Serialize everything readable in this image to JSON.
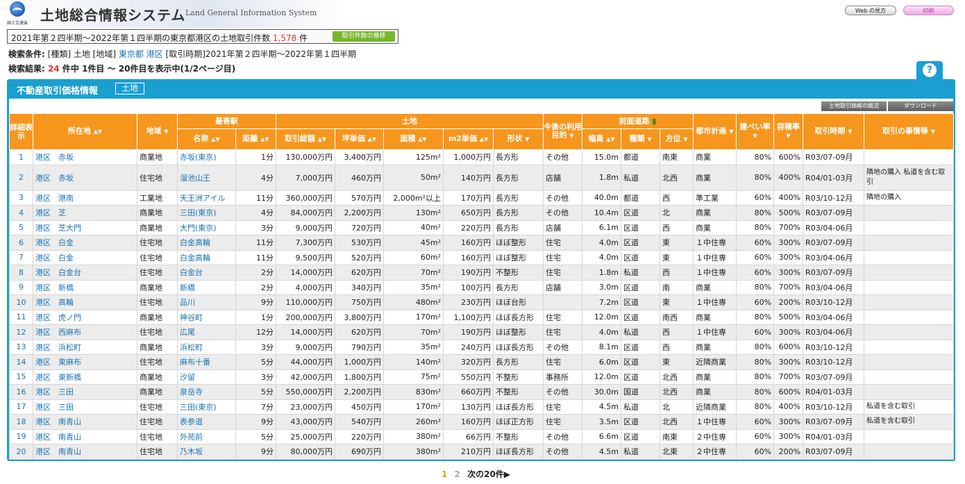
{
  "header": {
    "logo_text": "国土交通省",
    "title": "土地総合情報システム",
    "subtitle": "Land General Information System",
    "web_help_label": "Web の見方",
    "print_label": "印刷"
  },
  "summary": {
    "text_before": "2021年第２四半期〜2022年第１四半期の東京都港区の土地取引件数",
    "count": "1,578",
    "unit": "件",
    "trend_button": "取引件数の推移"
  },
  "conditions": {
    "label": "検索条件:",
    "type": "[種類] 土地",
    "area_label": "[地域]",
    "pref": "東京都",
    "city": "港区",
    "period": "[取引時期]2021年第２四半期〜2022年第１四半期"
  },
  "result": {
    "label": "検索結果:",
    "total": "24",
    "rest": "件中 1件目 〜 20件目を表示中(1/2ページ目)"
  },
  "panel": {
    "title": "不動産取引価格情報",
    "tag": "土地",
    "overview_button": "土地取引価格の概況",
    "download_button": "ダウンロード"
  },
  "table": {
    "headers": {
      "detail": "詳細表示",
      "location": "所在地",
      "district": "地域",
      "station_group": "最寄駅",
      "station_name": "名称",
      "distance": "距離",
      "land_group": "土地",
      "total_price": "取引総額",
      "tsubo_price": "坪単価",
      "area": "面積",
      "unit_price": "m2単価",
      "shape": "形状",
      "future_use": "今後の利用目的",
      "road_group": "前面道路",
      "width": "幅員",
      "road_type": "種類",
      "direction": "方位",
      "city_plan": "都市計画",
      "coverage": "建ぺい率",
      "floor_ratio": "容積率",
      "period": "取引時期",
      "circumstances": "取引の事情等"
    },
    "rows": [
      {
        "no": "1",
        "loc": "港区　赤坂",
        "district": "商業地",
        "station": "赤坂(東京)",
        "dist": "1分",
        "total": "130,000万円",
        "tsubo": "3,400万円",
        "area": "125m²",
        "unit": "1,000万円",
        "shape": "長方形",
        "use": "その他",
        "width": "15.0m",
        "rtype": "都道",
        "dir": "南東",
        "plan": "商業",
        "cov": "80%",
        "far": "600%",
        "period": "R03/07-09月",
        "note": ""
      },
      {
        "no": "2",
        "loc": "港区　赤坂",
        "district": "住宅地",
        "station": "溜池山王",
        "dist": "4分",
        "total": "7,000万円",
        "tsubo": "460万円",
        "area": "50m²",
        "unit": "140万円",
        "shape": "長方形",
        "use": "店舗",
        "width": "1.8m",
        "rtype": "私道",
        "dir": "北西",
        "plan": "商業",
        "cov": "80%",
        "far": "400%",
        "period": "R04/01-03月",
        "note": "隣地の購入 私道を含む取引"
      },
      {
        "no": "3",
        "loc": "港区　港南",
        "district": "工業地",
        "station": "天王洲アイル",
        "dist": "11分",
        "total": "360,000万円",
        "tsubo": "570万円",
        "area": "2,000m²以上",
        "unit": "170万円",
        "shape": "長方形",
        "use": "その他",
        "width": "40.0m",
        "rtype": "都道",
        "dir": "西",
        "plan": "準工業",
        "cov": "60%",
        "far": "400%",
        "period": "R03/10-12月",
        "note": "隣地の購入"
      },
      {
        "no": "4",
        "loc": "港区　芝",
        "district": "商業地",
        "station": "三田(東京)",
        "dist": "4分",
        "total": "84,000万円",
        "tsubo": "2,200万円",
        "area": "130m²",
        "unit": "650万円",
        "shape": "長方形",
        "use": "その他",
        "width": "10.4m",
        "rtype": "区道",
        "dir": "北",
        "plan": "商業",
        "cov": "80%",
        "far": "500%",
        "period": "R03/07-09月",
        "note": ""
      },
      {
        "no": "5",
        "loc": "港区　芝大門",
        "district": "商業地",
        "station": "大門(東京)",
        "dist": "3分",
        "total": "9,000万円",
        "tsubo": "720万円",
        "area": "40m²",
        "unit": "220万円",
        "shape": "長方形",
        "use": "店舗",
        "width": "6.1m",
        "rtype": "区道",
        "dir": "西",
        "plan": "商業",
        "cov": "80%",
        "far": "700%",
        "period": "R03/04-06月",
        "note": ""
      },
      {
        "no": "6",
        "loc": "港区　白金",
        "district": "住宅地",
        "station": "白金高輪",
        "dist": "11分",
        "total": "7,300万円",
        "tsubo": "530万円",
        "area": "45m²",
        "unit": "160万円",
        "shape": "ほぼ整形",
        "use": "住宅",
        "width": "4.0m",
        "rtype": "区道",
        "dir": "東",
        "plan": "１中住専",
        "cov": "60%",
        "far": "300%",
        "period": "R03/07-09月",
        "note": ""
      },
      {
        "no": "7",
        "loc": "港区　白金",
        "district": "住宅地",
        "station": "白金高輪",
        "dist": "11分",
        "total": "9,500万円",
        "tsubo": "520万円",
        "area": "60m²",
        "unit": "160万円",
        "shape": "ほぼ整形",
        "use": "住宅",
        "width": "4.0m",
        "rtype": "区道",
        "dir": "東",
        "plan": "１中住専",
        "cov": "60%",
        "far": "300%",
        "period": "R03/04-06月",
        "note": ""
      },
      {
        "no": "8",
        "loc": "港区　白金台",
        "district": "住宅地",
        "station": "白金台",
        "dist": "2分",
        "total": "14,000万円",
        "tsubo": "620万円",
        "area": "70m²",
        "unit": "190万円",
        "shape": "不整形",
        "use": "住宅",
        "width": "1.8m",
        "rtype": "私道",
        "dir": "西",
        "plan": "１中住専",
        "cov": "60%",
        "far": "300%",
        "period": "R03/07-09月",
        "note": ""
      },
      {
        "no": "9",
        "loc": "港区　新橋",
        "district": "商業地",
        "station": "新橋",
        "dist": "2分",
        "total": "4,000万円",
        "tsubo": "340万円",
        "area": "35m²",
        "unit": "100万円",
        "shape": "長方形",
        "use": "店舗",
        "width": "3.0m",
        "rtype": "区道",
        "dir": "南",
        "plan": "商業",
        "cov": "80%",
        "far": "700%",
        "period": "R03/04-06月",
        "note": ""
      },
      {
        "no": "10",
        "loc": "港区　高輪",
        "district": "住宅地",
        "station": "品川",
        "dist": "9分",
        "total": "110,000万円",
        "tsubo": "750万円",
        "area": "480m²",
        "unit": "230万円",
        "shape": "ほぼ台形",
        "use": "",
        "width": "7.2m",
        "rtype": "区道",
        "dir": "東",
        "plan": "１中住専",
        "cov": "60%",
        "far": "200%",
        "period": "R03/10-12月",
        "note": ""
      },
      {
        "no": "11",
        "loc": "港区　虎ノ門",
        "district": "商業地",
        "station": "神谷町",
        "dist": "1分",
        "total": "200,000万円",
        "tsubo": "3,800万円",
        "area": "170m²",
        "unit": "1,100万円",
        "shape": "ほぼ長方形",
        "use": "住宅",
        "width": "12.0m",
        "rtype": "区道",
        "dir": "南西",
        "plan": "商業",
        "cov": "80%",
        "far": "500%",
        "period": "R03/04-06月",
        "note": ""
      },
      {
        "no": "12",
        "loc": "港区　西麻布",
        "district": "住宅地",
        "station": "広尾",
        "dist": "12分",
        "total": "14,000万円",
        "tsubo": "620万円",
        "area": "70m²",
        "unit": "190万円",
        "shape": "ほぼ整形",
        "use": "住宅",
        "width": "4.0m",
        "rtype": "私道",
        "dir": "西",
        "plan": "１中住専",
        "cov": "60%",
        "far": "300%",
        "period": "R03/04-06月",
        "note": ""
      },
      {
        "no": "13",
        "loc": "港区　浜松町",
        "district": "商業地",
        "station": "浜松町",
        "dist": "3分",
        "total": "9,000万円",
        "tsubo": "790万円",
        "area": "35m²",
        "unit": "240万円",
        "shape": "ほぼ長方形",
        "use": "その他",
        "width": "8.1m",
        "rtype": "区道",
        "dir": "西",
        "plan": "商業",
        "cov": "80%",
        "far": "600%",
        "period": "R03/10-12月",
        "note": ""
      },
      {
        "no": "14",
        "loc": "港区　東麻布",
        "district": "住宅地",
        "station": "麻布十番",
        "dist": "5分",
        "total": "44,000万円",
        "tsubo": "1,000万円",
        "area": "140m²",
        "unit": "320万円",
        "shape": "長方形",
        "use": "住宅",
        "width": "6.0m",
        "rtype": "区道",
        "dir": "東",
        "plan": "近隣商業",
        "cov": "80%",
        "far": "300%",
        "period": "R03/10-12月",
        "note": ""
      },
      {
        "no": "15",
        "loc": "港区　東新橋",
        "district": "商業地",
        "station": "汐留",
        "dist": "3分",
        "total": "42,000万円",
        "tsubo": "1,800万円",
        "area": "75m²",
        "unit": "550万円",
        "shape": "不整形",
        "use": "事務所",
        "width": "12.0m",
        "rtype": "区道",
        "dir": "北西",
        "plan": "商業",
        "cov": "80%",
        "far": "700%",
        "period": "R03/07-09月",
        "note": ""
      },
      {
        "no": "16",
        "loc": "港区　三田",
        "district": "商業地",
        "station": "泉岳寺",
        "dist": "5分",
        "total": "550,000万円",
        "tsubo": "2,200万円",
        "area": "830m²",
        "unit": "660万円",
        "shape": "不整形",
        "use": "その他",
        "width": "30.0m",
        "rtype": "国道",
        "dir": "北西",
        "plan": "商業",
        "cov": "80%",
        "far": "600%",
        "period": "R04/01-03月",
        "note": ""
      },
      {
        "no": "17",
        "loc": "港区　三田",
        "district": "住宅地",
        "station": "三田(東京)",
        "dist": "7分",
        "total": "23,000万円",
        "tsubo": "450万円",
        "area": "170m²",
        "unit": "130万円",
        "shape": "ほぼ長方形",
        "use": "住宅",
        "width": "4.5m",
        "rtype": "私道",
        "dir": "北",
        "plan": "近隣商業",
        "cov": "80%",
        "far": "400%",
        "period": "R03/10-12月",
        "note": "私道を含む取引"
      },
      {
        "no": "18",
        "loc": "港区　南青山",
        "district": "住宅地",
        "station": "表参道",
        "dist": "9分",
        "total": "43,000万円",
        "tsubo": "540万円",
        "area": "260m²",
        "unit": "160万円",
        "shape": "ほぼ正方形",
        "use": "住宅",
        "width": "3.5m",
        "rtype": "区道",
        "dir": "北西",
        "plan": "１中住専",
        "cov": "60%",
        "far": "300%",
        "period": "R03/07-09月",
        "note": "私道を含む取引"
      },
      {
        "no": "19",
        "loc": "港区　南青山",
        "district": "住宅地",
        "station": "外苑前",
        "dist": "5分",
        "total": "25,000万円",
        "tsubo": "220万円",
        "area": "380m²",
        "unit": "66万円",
        "shape": "不整形",
        "use": "その他",
        "width": "6.6m",
        "rtype": "区道",
        "dir": "南東",
        "plan": "２中住専",
        "cov": "60%",
        "far": "300%",
        "period": "R04/01-03月",
        "note": ""
      },
      {
        "no": "20",
        "loc": "港区　南青山",
        "district": "住宅地",
        "station": "乃木坂",
        "dist": "9分",
        "total": "80,000万円",
        "tsubo": "690万円",
        "area": "380m²",
        "unit": "210万円",
        "shape": "ほぼ長方形",
        "use": "その他",
        "width": "4.5m",
        "rtype": "私道",
        "dir": "北東",
        "plan": "２中住専",
        "cov": "60%",
        "far": "200%",
        "period": "R03/07-09月",
        "note": ""
      }
    ]
  },
  "pager": {
    "current": "1",
    "page2": "2",
    "next": "次の20件▶"
  },
  "icons": {
    "sort": "sort-updown-icon",
    "filter": "filter-down-icon",
    "road_chart": "bar-chart-icon",
    "help": "question-icon"
  }
}
